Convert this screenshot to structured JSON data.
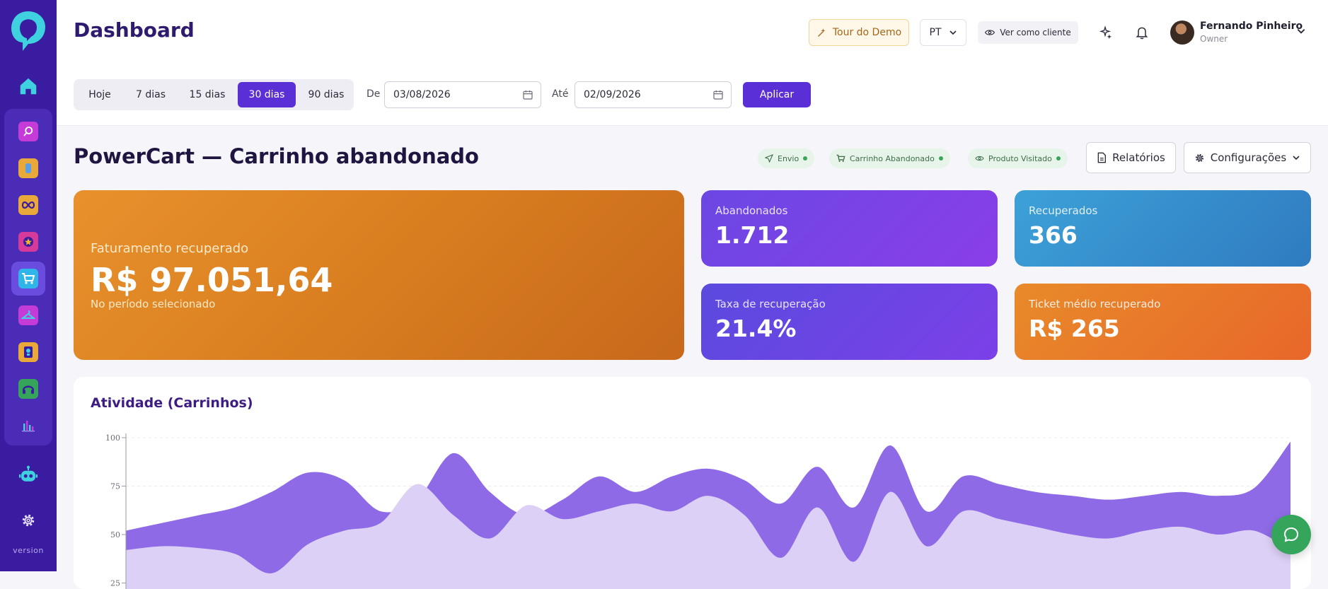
{
  "sidebar": {
    "version_label": "version",
    "apps": [
      "search-app",
      "bot-app",
      "infinity-app",
      "star-app",
      "cart-app",
      "hanger-app",
      "bulb-app",
      "headset-app",
      "chart-app"
    ]
  },
  "header": {
    "title": "Dashboard",
    "tour_label": "Tour do Demo",
    "language": "PT",
    "view_as_client": "Ver como cliente",
    "user_name": "Fernando Pinheiro",
    "user_role": "Owner"
  },
  "filters": {
    "ranges": [
      "Hoje",
      "7 dias",
      "15 dias",
      "30 dias",
      "90 dias"
    ],
    "active_range": "30 dias",
    "from_label": "De",
    "from_date": "03/08/2026",
    "to_label": "Até",
    "to_date": "02/09/2026",
    "apply_label": "Aplicar"
  },
  "section": {
    "title": "PowerCart — Carrinho abandonado",
    "tags": [
      "Envio",
      "Carrinho Abandonado",
      "Produto Visitado"
    ],
    "reports_label": "Relatórios",
    "settings_label": "Configurações"
  },
  "kpis": {
    "revenue_label": "Faturamento recuperado",
    "revenue_value": "R$ 97.051,64",
    "revenue_sub": "No período selecionado",
    "abandoned_label": "Abandonados",
    "abandoned_value": "1.712",
    "recovered_label": "Recuperados",
    "recovered_value": "366",
    "rate_label": "Taxa de recuperação",
    "rate_value": "21.4%",
    "ticket_label": "Ticket médio recuperado",
    "ticket_value": "R$ 265"
  },
  "colors": {
    "primary": "#5b2fd6",
    "sidebar": "#3a1ca0",
    "orange": "#d97e20",
    "purple": "#7c3aed",
    "blue": "#3b8dd0",
    "green": "#34a55a"
  },
  "chart_data": {
    "type": "area",
    "title": "Atividade (Carrinhos)",
    "ylim": [
      0,
      100
    ],
    "y_ticks": [
      "100",
      "75",
      "50",
      "25"
    ],
    "grid": true,
    "series": [
      {
        "values": [
          52,
          56,
          60,
          64,
          72,
          82,
          78,
          62,
          68,
          92,
          72,
          60,
          68,
          80,
          72,
          80,
          84,
          78,
          66,
          85,
          64,
          96,
          62,
          80,
          76,
          72,
          70,
          68,
          70,
          72,
          70,
          74,
          98
        ]
      },
      {
        "values": [
          42,
          44,
          43,
          40,
          30,
          45,
          52,
          56,
          76,
          60,
          48,
          65,
          58,
          62,
          66,
          62,
          70,
          60,
          38,
          64,
          36,
          72,
          44,
          62,
          58,
          54,
          50,
          48,
          52,
          54,
          50,
          52,
          42
        ]
      }
    ]
  }
}
